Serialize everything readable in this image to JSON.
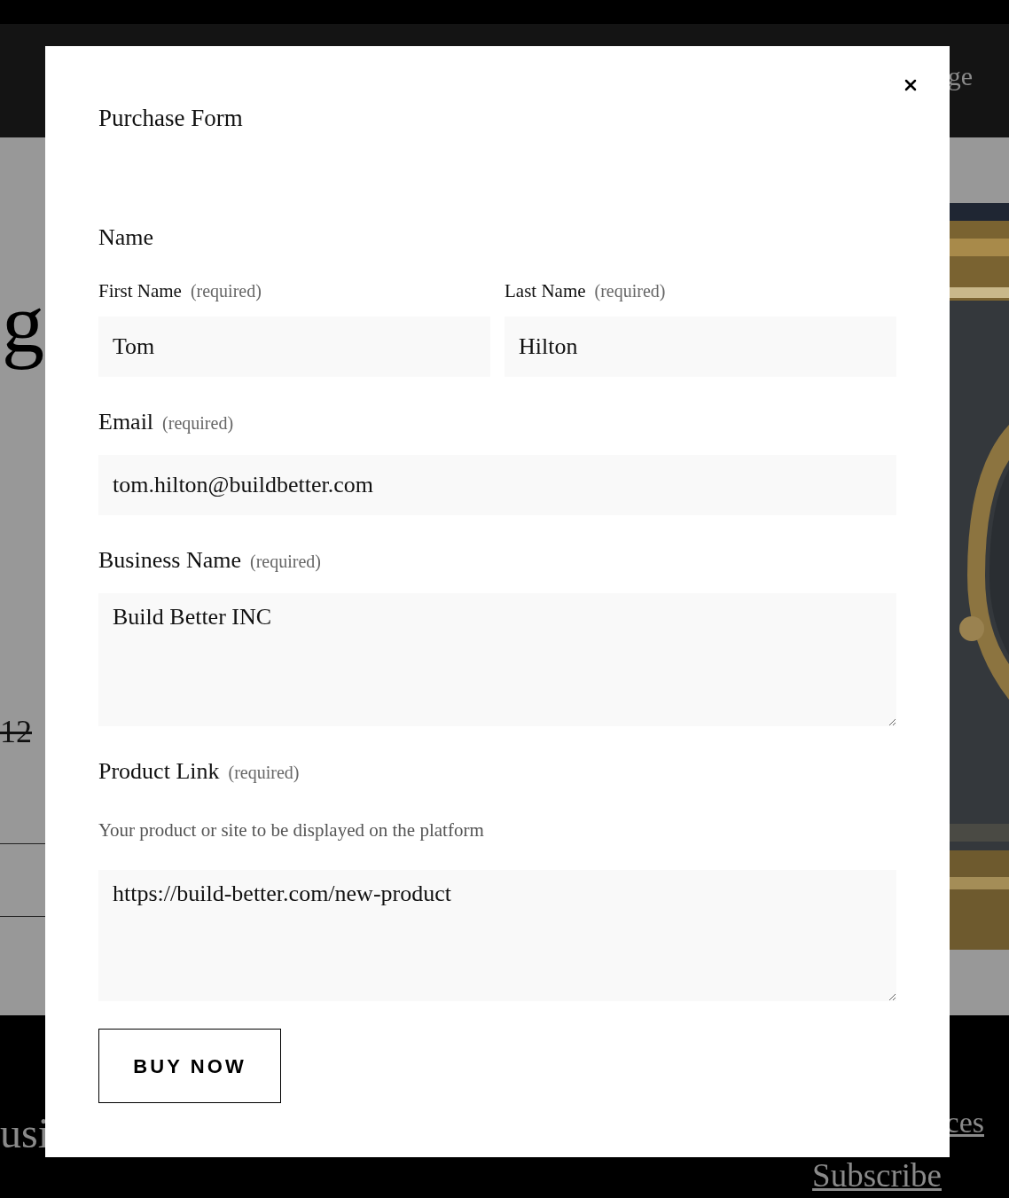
{
  "background": {
    "header_text": "ge",
    "heading_fragment": "g",
    "price_fragment": "12",
    "footer_left_fragment": "usi",
    "footer_link": "ces",
    "subscribe_link": "Subscribe"
  },
  "modal": {
    "title": "Purchase Form",
    "fields": [
      {
        "kind": "group",
        "label": "Name",
        "fields": [
          {
            "label": "First Name",
            "note": "(required)",
            "value": "Tom"
          },
          {
            "label": "Last Name",
            "note": "(required)",
            "value": "Hilton"
          }
        ]
      },
      {
        "kind": "input",
        "label": "Email",
        "note": "(required)",
        "value": "tom.hilton@buildbetter.com"
      },
      {
        "kind": "textarea",
        "label": "Business Name",
        "note": "(required)",
        "value": "Build Better INC"
      },
      {
        "kind": "textarea",
        "label": "Product Link",
        "note": "(required)",
        "description": "Your product or site to be displayed on the platform",
        "value": "https://build-better.com/new-product"
      }
    ],
    "submit": "BUY NOW"
  }
}
